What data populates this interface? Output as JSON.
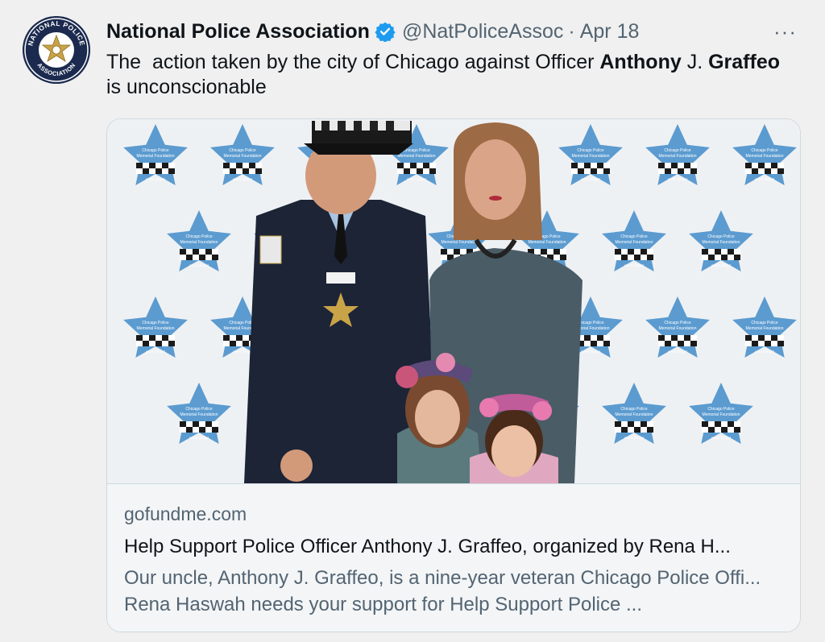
{
  "author": {
    "name": "National Police Association",
    "handle": "@NatPoliceAssoc",
    "separator": "·",
    "date": "Apr 18",
    "avatar_text_top": "NATIONAL POLICE",
    "avatar_text_bottom": "ASSOCIATION"
  },
  "more_label": "···",
  "tweet": {
    "text_part1": "The  action taken by the city of Chicago against Officer ",
    "bold1": "Anthony",
    "text_part2": " J. ",
    "bold2": "Graffeo",
    "text_part3": " is unconscionable"
  },
  "card": {
    "domain": "gofundme.com",
    "title": "Help Support Police Officer Anthony J. Graffeo, organized by Rena H...",
    "description": "Our uncle, Anthony J. Graffeo, is a nine-year veteran Chicago Police Offi... Rena Haswah needs your support for Help Support Police ...",
    "backdrop_label_1": "Chicago Police",
    "backdrop_label_2": "Memorial Foundation",
    "backdrop_tagline": "never forget"
  },
  "colors": {
    "background": "#f0f0f0",
    "text": "#0f1419",
    "secondary": "#536471",
    "verified": "#1d9bf0",
    "star": "#5b9bd0",
    "avatar_bg": "#1b2a4e",
    "badge_gold": "#c9a347"
  },
  "icons": [
    "verified-badge-icon",
    "more-icon",
    "police-star-logo"
  ]
}
